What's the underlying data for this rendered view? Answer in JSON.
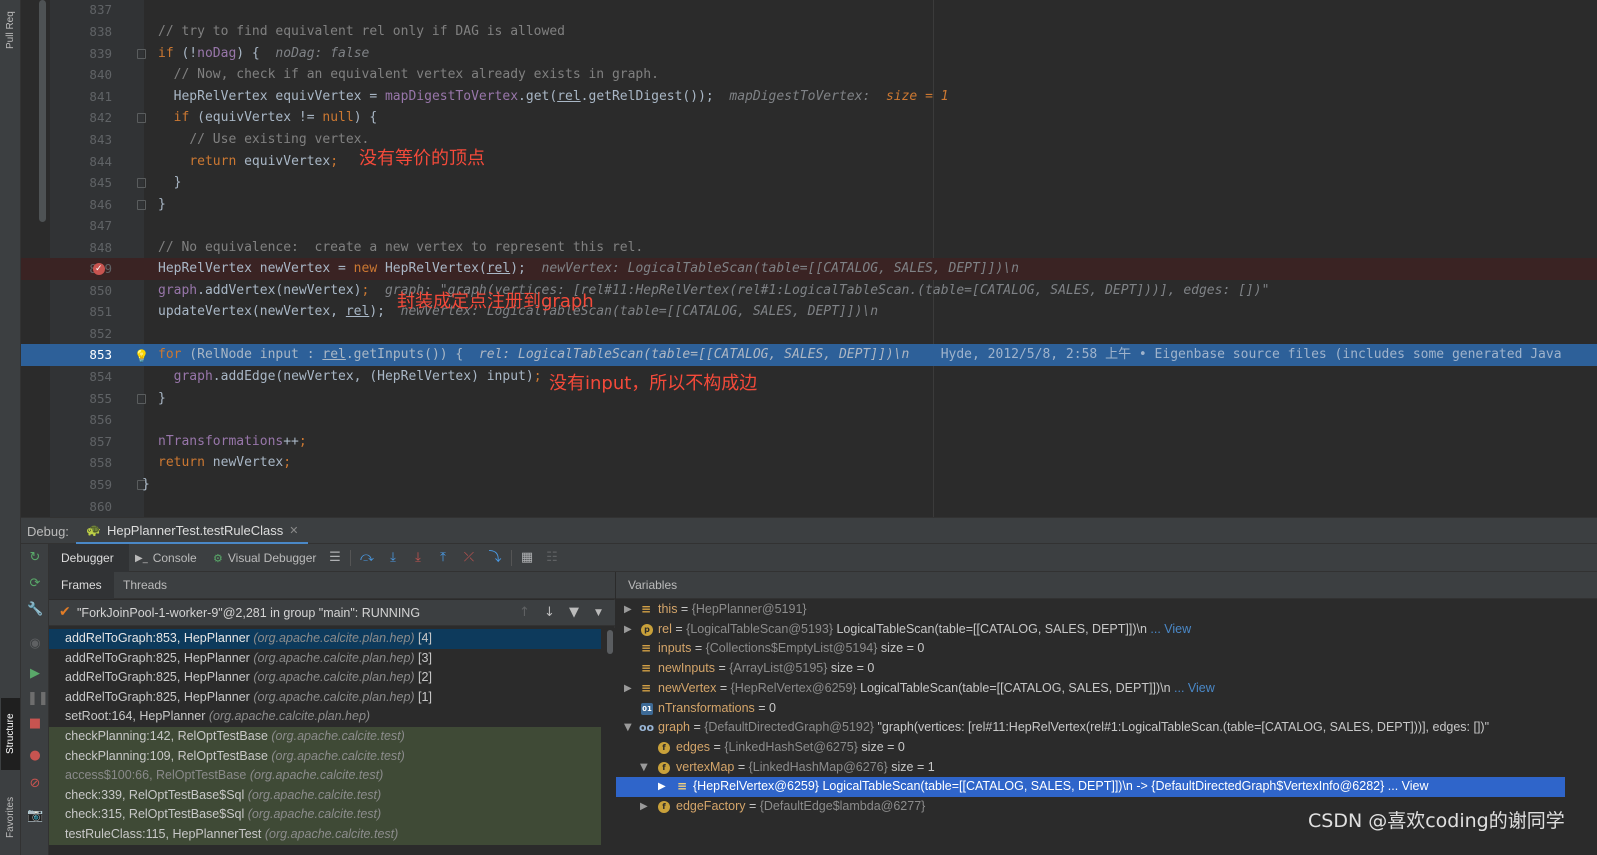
{
  "tool_strip": {
    "pull_requests": "Pull Req",
    "structure": "Structure",
    "favorites": "Favorites"
  },
  "editor": {
    "lines": [
      {
        "n": "837"
      },
      {
        "n": "838"
      },
      {
        "n": "839"
      },
      {
        "n": "840"
      },
      {
        "n": "841"
      },
      {
        "n": "842"
      },
      {
        "n": "843"
      },
      {
        "n": "844"
      },
      {
        "n": "845"
      },
      {
        "n": "846"
      },
      {
        "n": "847"
      },
      {
        "n": "848"
      },
      {
        "n": "849"
      },
      {
        "n": "850"
      },
      {
        "n": "851"
      },
      {
        "n": "852"
      },
      {
        "n": "853"
      },
      {
        "n": "854"
      },
      {
        "n": "855"
      },
      {
        "n": "856"
      },
      {
        "n": "857"
      },
      {
        "n": "858"
      },
      {
        "n": "859"
      },
      {
        "n": "860"
      }
    ],
    "code": {
      "l838": "// try to find equivalent rel only if DAG is allowed",
      "l839_kw": "if",
      "l839_a": " (!",
      "l839_b": "noDag",
      "l839_c": ") {",
      "l839_hint": "noDag: false",
      "l840": "// Now, check if an equivalent vertex already exists in graph.",
      "l841_a": "HepRelVertex equivVertex = ",
      "l841_fld": "mapDigestToVertex",
      "l841_b": ".get(",
      "l841_rel": "rel",
      "l841_c": ".getRelDigest());",
      "l841_hint": "mapDigestToVertex:",
      "l841_hint_num": "size = 1",
      "l842_kw": "if",
      "l842_a": " (equivVertex != ",
      "l842_null": "null",
      "l842_b": ") {",
      "l843": "// Use existing vertex.",
      "l844_kw": "return",
      "l844_a": " equivVertex",
      "l844_semi": ";",
      "l845": "}",
      "l846": "}",
      "l848": "// No equivalence:  create a new vertex to represent this rel.",
      "l849_a": "HepRelVertex newVertex = ",
      "l849_kw": "new",
      "l849_b": " HepRelVertex(",
      "l849_rel": "rel",
      "l849_c": ");",
      "l849_hint": "newVertex: LogicalTableScan(table=[[CATALOG, SALES, DEPT]])\\n",
      "l850_fld": "graph",
      "l850_a": ".addVertex(newVertex)",
      "l850_semi": ";",
      "l850_hint": "graph: \"graph(vertices: [rel#11:HepRelVertex(rel#1:LogicalTableScan.(table=[CATALOG, SALES, DEPT]))], edges: [])\"",
      "l851_a": "updateVertex(newVertex, ",
      "l851_rel": "rel",
      "l851_b": ");",
      "l851_hint": "newVertex: LogicalTableScan(table=[[CATALOG, SALES, DEPT]])\\n",
      "l853_kw": "for",
      "l853_a": " (RelNode input : ",
      "l853_rel": "rel",
      "l853_b": ".getInputs()) {",
      "l853_hint": "rel: LogicalTableScan(table=[[CATALOG, SALES, DEPT]])\\n",
      "l853_blame": "Hyde, 2012/5/8, 2:58 上午 • Eigenbase source files (includes some generated Java",
      "l854_fld": "graph",
      "l854_a": ".addEdge(newVertex, (HepRelVertex) input)",
      "l854_semi": ";",
      "l855": "}",
      "l857_fld": "nTransformations",
      "l857_a": "++",
      "l857_semi": ";",
      "l858_kw": "return",
      "l858_a": " newVertex",
      "l858_semi": ";",
      "l859": "}"
    },
    "annotations": {
      "a1": "没有等价的顶点",
      "a2": "封装成定点注册到graph",
      "a3": "没有input，所以不构成边"
    }
  },
  "debug": {
    "label": "Debug:",
    "session": "HepPlannerTest.testRuleClass",
    "tabs": {
      "debugger": "Debugger",
      "console": "Console",
      "visual": "Visual Debugger"
    },
    "frames_tab": "Frames",
    "threads_tab": "Threads",
    "thread": "\"ForkJoinPool-1-worker-9\"@2,281 in group \"main\": RUNNING",
    "frames": [
      {
        "m": "addRelToGraph:853, HepPlanner",
        "p": "(org.apache.calcite.plan.hep)",
        "i": "[4]"
      },
      {
        "m": "addRelToGraph:825, HepPlanner",
        "p": "(org.apache.calcite.plan.hep)",
        "i": "[3]"
      },
      {
        "m": "addRelToGraph:825, HepPlanner",
        "p": "(org.apache.calcite.plan.hep)",
        "i": "[2]"
      },
      {
        "m": "addRelToGraph:825, HepPlanner",
        "p": "(org.apache.calcite.plan.hep)",
        "i": "[1]"
      },
      {
        "m": "setRoot:164, HepPlanner",
        "p": "(org.apache.calcite.plan.hep)",
        "i": ""
      },
      {
        "m": "checkPlanning:142, RelOptTestBase",
        "p": "(org.apache.calcite.test)",
        "i": ""
      },
      {
        "m": "checkPlanning:109, RelOptTestBase",
        "p": "(org.apache.calcite.test)",
        "i": ""
      },
      {
        "m": "access$100:66, RelOptTestBase",
        "p": "(org.apache.calcite.test)",
        "i": ""
      },
      {
        "m": "check:339, RelOptTestBase$Sql",
        "p": "(org.apache.calcite.test)",
        "i": ""
      },
      {
        "m": "check:315, RelOptTestBase$Sql",
        "p": "(org.apache.calcite.test)",
        "i": ""
      },
      {
        "m": "testRuleClass:115, HepPlannerTest",
        "p": "(org.apache.calcite.test)",
        "i": ""
      }
    ],
    "variables_title": "Variables",
    "vars": [
      {
        "name": "this",
        "eq": " = ",
        "type": "{HepPlanner@5191}",
        "val": "",
        "link": ""
      },
      {
        "name": "rel",
        "eq": " = ",
        "type": "{LogicalTableScan@5193}",
        "val": " LogicalTableScan(table=[[CATALOG, SALES, DEPT]])\\n",
        "link": " ... View"
      },
      {
        "name": "inputs",
        "eq": " = ",
        "type": "{Collections$EmptyList@5194}",
        "val": "  size = 0",
        "link": ""
      },
      {
        "name": "newInputs",
        "eq": " = ",
        "type": "{ArrayList@5195}",
        "val": "  size = 0",
        "link": ""
      },
      {
        "name": "newVertex",
        "eq": " = ",
        "type": "{HepRelVertex@6259}",
        "val": " LogicalTableScan(table=[[CATALOG, SALES, DEPT]])\\n",
        "link": " ... View"
      },
      {
        "name": "nTransformations",
        "eq": " = 0",
        "type": "",
        "val": "",
        "link": ""
      },
      {
        "name": "graph",
        "eq": " = ",
        "type": "{DefaultDirectedGraph@5192}",
        "val": " \"graph(vertices: [rel#11:HepRelVertex(rel#1:LogicalTableScan.(table=[CATALOG, SALES, DEPT]))], edges: [])\"",
        "link": ""
      },
      {
        "name": "edges",
        "eq": " = ",
        "type": "{LinkedHashSet@6275}",
        "val": "  size = 0",
        "link": ""
      },
      {
        "name": "vertexMap",
        "eq": " = ",
        "type": "{LinkedHashMap@6276}",
        "val": "  size = 1",
        "link": ""
      },
      {
        "name": "",
        "eq": "",
        "type": "",
        "val": "{HepRelVertex@6259} LogicalTableScan(table=[[CATALOG, SALES, DEPT]])\\n -> {DefaultDirectedGraph$VertexInfo@6282}",
        "link": " ... View"
      },
      {
        "name": "edgeFactory",
        "eq": " = ",
        "type": "{DefaultEdge$lambda@6277}",
        "val": "",
        "link": ""
      }
    ]
  },
  "watermark": "CSDN @喜欢coding的谢同学",
  "colors": {
    "keyword": "#cc7832",
    "comment": "#808080",
    "field": "#9876aa",
    "exec_line": "#2d6099",
    "annotation": "#f44a3a",
    "selection": "#2f65ca"
  }
}
